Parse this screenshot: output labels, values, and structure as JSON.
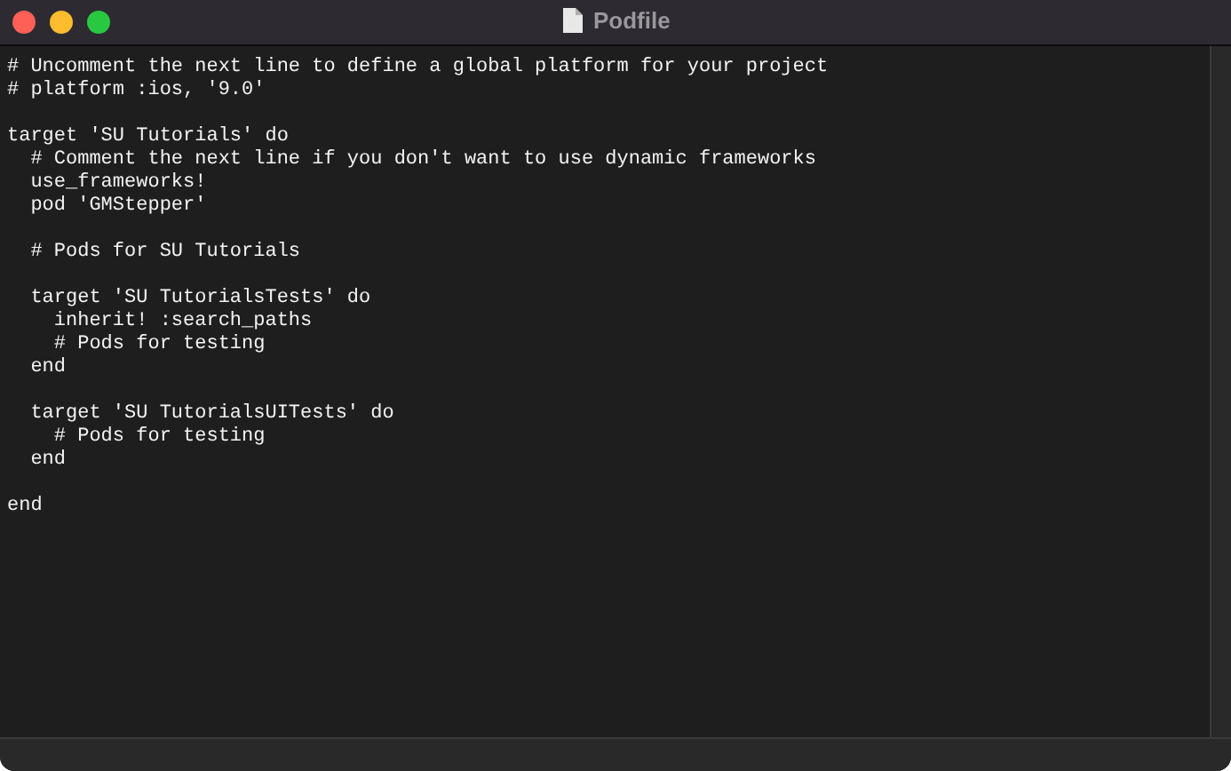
{
  "window": {
    "title": "Podfile"
  },
  "lines": [
    {
      "kind": "code",
      "text": "# Uncomment the next line to define a global platform for your project"
    },
    {
      "kind": "code",
      "text": "# platform :ios, '9.0'"
    },
    {
      "kind": "blank"
    },
    {
      "kind": "code",
      "text": "target 'SU Tutorials' do"
    },
    {
      "kind": "code",
      "text": "  # Comment the next line if you don't want to use dynamic frameworks"
    },
    {
      "kind": "code",
      "text": "  use_frameworks!"
    },
    {
      "kind": "code",
      "text": "  pod 'GMStepper'"
    },
    {
      "kind": "blank"
    },
    {
      "kind": "code",
      "text": "  # Pods for SU Tutorials"
    },
    {
      "kind": "blank"
    },
    {
      "kind": "code",
      "text": "  target 'SU TutorialsTests' do"
    },
    {
      "kind": "code",
      "text": "    inherit! :search_paths"
    },
    {
      "kind": "code",
      "text": "    # Pods for testing"
    },
    {
      "kind": "code",
      "text": "  end"
    },
    {
      "kind": "blank"
    },
    {
      "kind": "code",
      "text": "  target 'SU TutorialsUITests' do"
    },
    {
      "kind": "code",
      "text": "    # Pods for testing"
    },
    {
      "kind": "code",
      "text": "  end"
    },
    {
      "kind": "blank"
    },
    {
      "kind": "code",
      "text": "end"
    }
  ]
}
